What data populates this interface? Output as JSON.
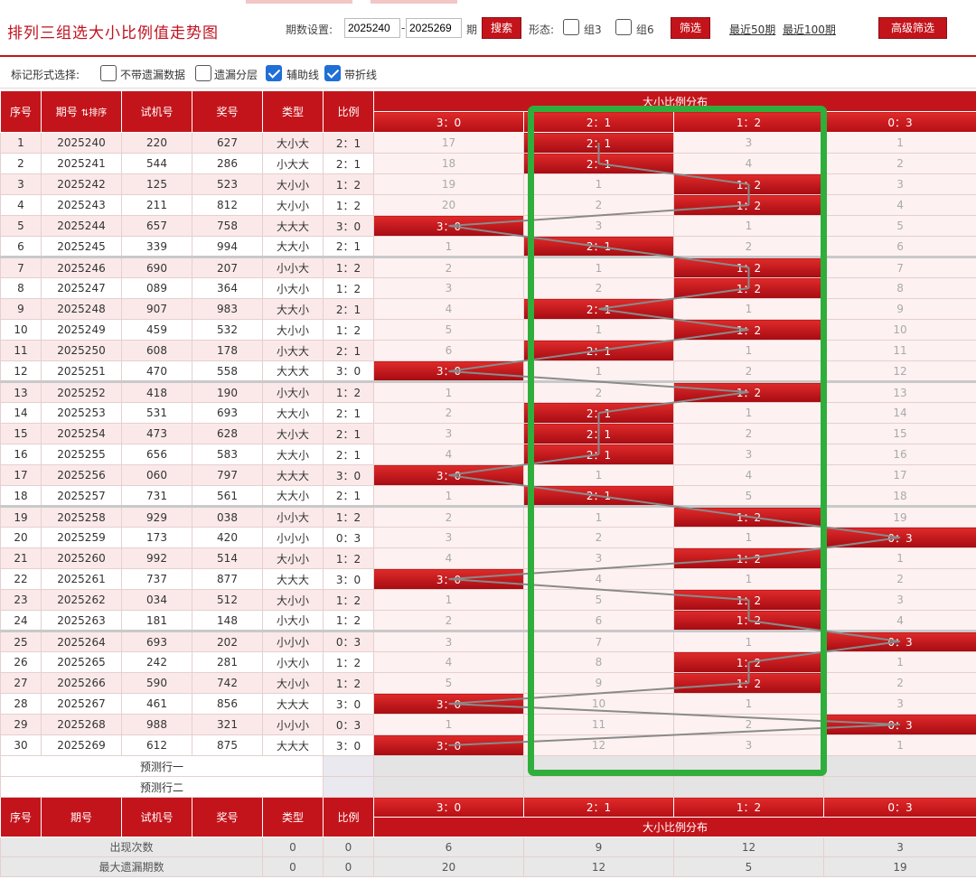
{
  "header": {
    "title": "排列三组选大小比例值走势图",
    "period_label": "期数设置:",
    "period_from": "2025240",
    "period_to": "2025269",
    "period_suffix": "期",
    "search_label": "搜索",
    "form_label": "形态:",
    "form_opt1": "组3",
    "form_opt2": "组6",
    "filter_label": "筛选",
    "recent50": "最近50期",
    "recent100": "最近100期",
    "advanced": "高级筛选"
  },
  "options": {
    "label": "标记形式选择:",
    "opt1": "不带遗漏数据",
    "opt2": "遗漏分层",
    "opt3": "辅助线",
    "opt4": "带折线",
    "opt1_checked": false,
    "opt2_checked": false,
    "opt3_checked": true,
    "opt4_checked": true
  },
  "columns": {
    "seq": "序号",
    "issue": "期号",
    "sort": "排序",
    "test": "试机号",
    "prize": "奖号",
    "type": "类型",
    "ratio": "比例",
    "dist_title": "大小比例分布",
    "dist": [
      "3：0",
      "2：1",
      "1：2",
      "0：3"
    ]
  },
  "rows": [
    {
      "seq": "1",
      "issue": "2025240",
      "test": "220",
      "prize": "627",
      "type": "大小大",
      "ratio": "2：1",
      "hit": 1,
      "miss": [
        "17",
        "",
        "3",
        "1"
      ]
    },
    {
      "seq": "2",
      "issue": "2025241",
      "test": "544",
      "prize": "286",
      "type": "小大大",
      "ratio": "2：1",
      "hit": 1,
      "miss": [
        "18",
        "",
        "4",
        "2"
      ]
    },
    {
      "seq": "3",
      "issue": "2025242",
      "test": "125",
      "prize": "523",
      "type": "大小小",
      "ratio": "1：2",
      "hit": 2,
      "miss": [
        "19",
        "1",
        "",
        "3"
      ]
    },
    {
      "seq": "4",
      "issue": "2025243",
      "test": "211",
      "prize": "812",
      "type": "大小小",
      "ratio": "1：2",
      "hit": 2,
      "miss": [
        "20",
        "2",
        "",
        "4"
      ]
    },
    {
      "seq": "5",
      "issue": "2025244",
      "test": "657",
      "prize": "758",
      "type": "大大大",
      "ratio": "3：0",
      "hit": 0,
      "miss": [
        "",
        "3",
        "1",
        "5"
      ]
    },
    {
      "seq": "6",
      "issue": "2025245",
      "test": "339",
      "prize": "994",
      "type": "大大小",
      "ratio": "2：1",
      "hit": 1,
      "miss": [
        "1",
        "",
        "2",
        "6"
      ]
    },
    {
      "seq": "7",
      "issue": "2025246",
      "test": "690",
      "prize": "207",
      "type": "小小大",
      "ratio": "1：2",
      "hit": 2,
      "miss": [
        "2",
        "1",
        "",
        "7"
      ]
    },
    {
      "seq": "8",
      "issue": "2025247",
      "test": "089",
      "prize": "364",
      "type": "小大小",
      "ratio": "1：2",
      "hit": 2,
      "miss": [
        "3",
        "2",
        "",
        "8"
      ]
    },
    {
      "seq": "9",
      "issue": "2025248",
      "test": "907",
      "prize": "983",
      "type": "大大小",
      "ratio": "2：1",
      "hit": 1,
      "miss": [
        "4",
        "",
        "1",
        "9"
      ]
    },
    {
      "seq": "10",
      "issue": "2025249",
      "test": "459",
      "prize": "532",
      "type": "大小小",
      "ratio": "1：2",
      "hit": 2,
      "miss": [
        "5",
        "1",
        "",
        "10"
      ]
    },
    {
      "seq": "11",
      "issue": "2025250",
      "test": "608",
      "prize": "178",
      "type": "小大大",
      "ratio": "2：1",
      "hit": 1,
      "miss": [
        "6",
        "",
        "1",
        "11"
      ]
    },
    {
      "seq": "12",
      "issue": "2025251",
      "test": "470",
      "prize": "558",
      "type": "大大大",
      "ratio": "3：0",
      "hit": 0,
      "miss": [
        "",
        "1",
        "2",
        "12"
      ]
    },
    {
      "seq": "13",
      "issue": "2025252",
      "test": "418",
      "prize": "190",
      "type": "小大小",
      "ratio": "1：2",
      "hit": 2,
      "miss": [
        "1",
        "2",
        "",
        "13"
      ]
    },
    {
      "seq": "14",
      "issue": "2025253",
      "test": "531",
      "prize": "693",
      "type": "大大小",
      "ratio": "2：1",
      "hit": 1,
      "miss": [
        "2",
        "",
        "1",
        "14"
      ]
    },
    {
      "seq": "15",
      "issue": "2025254",
      "test": "473",
      "prize": "628",
      "type": "大小大",
      "ratio": "2：1",
      "hit": 1,
      "miss": [
        "3",
        "",
        "2",
        "15"
      ]
    },
    {
      "seq": "16",
      "issue": "2025255",
      "test": "656",
      "prize": "583",
      "type": "大大小",
      "ratio": "2：1",
      "hit": 1,
      "miss": [
        "4",
        "",
        "3",
        "16"
      ]
    },
    {
      "seq": "17",
      "issue": "2025256",
      "test": "060",
      "prize": "797",
      "type": "大大大",
      "ratio": "3：0",
      "hit": 0,
      "miss": [
        "",
        "1",
        "4",
        "17"
      ]
    },
    {
      "seq": "18",
      "issue": "2025257",
      "test": "731",
      "prize": "561",
      "type": "大大小",
      "ratio": "2：1",
      "hit": 1,
      "miss": [
        "1",
        "",
        "5",
        "18"
      ]
    },
    {
      "seq": "19",
      "issue": "2025258",
      "test": "929",
      "prize": "038",
      "type": "小小大",
      "ratio": "1：2",
      "hit": 2,
      "miss": [
        "2",
        "1",
        "",
        "19"
      ]
    },
    {
      "seq": "20",
      "issue": "2025259",
      "test": "173",
      "prize": "420",
      "type": "小小小",
      "ratio": "0：3",
      "hit": 3,
      "miss": [
        "3",
        "2",
        "1",
        ""
      ]
    },
    {
      "seq": "21",
      "issue": "2025260",
      "test": "992",
      "prize": "514",
      "type": "大小小",
      "ratio": "1：2",
      "hit": 2,
      "miss": [
        "4",
        "3",
        "",
        "1"
      ]
    },
    {
      "seq": "22",
      "issue": "2025261",
      "test": "737",
      "prize": "877",
      "type": "大大大",
      "ratio": "3：0",
      "hit": 0,
      "miss": [
        "",
        "4",
        "1",
        "2"
      ]
    },
    {
      "seq": "23",
      "issue": "2025262",
      "test": "034",
      "prize": "512",
      "type": "大小小",
      "ratio": "1：2",
      "hit": 2,
      "miss": [
        "1",
        "5",
        "",
        "3"
      ]
    },
    {
      "seq": "24",
      "issue": "2025263",
      "test": "181",
      "prize": "148",
      "type": "小大小",
      "ratio": "1：2",
      "hit": 2,
      "miss": [
        "2",
        "6",
        "",
        "4"
      ]
    },
    {
      "seq": "25",
      "issue": "2025264",
      "test": "693",
      "prize": "202",
      "type": "小小小",
      "ratio": "0：3",
      "hit": 3,
      "miss": [
        "3",
        "7",
        "1",
        ""
      ]
    },
    {
      "seq": "26",
      "issue": "2025265",
      "test": "242",
      "prize": "281",
      "type": "小大小",
      "ratio": "1：2",
      "hit": 2,
      "miss": [
        "4",
        "8",
        "",
        "1"
      ]
    },
    {
      "seq": "27",
      "issue": "2025266",
      "test": "590",
      "prize": "742",
      "type": "大小小",
      "ratio": "1：2",
      "hit": 2,
      "miss": [
        "5",
        "9",
        "",
        "2"
      ]
    },
    {
      "seq": "28",
      "issue": "2025267",
      "test": "461",
      "prize": "856",
      "type": "大大大",
      "ratio": "3：0",
      "hit": 0,
      "miss": [
        "",
        "10",
        "1",
        "3"
      ]
    },
    {
      "seq": "29",
      "issue": "2025268",
      "test": "988",
      "prize": "321",
      "type": "小小小",
      "ratio": "0：3",
      "hit": 3,
      "miss": [
        "1",
        "11",
        "2",
        ""
      ]
    },
    {
      "seq": "30",
      "issue": "2025269",
      "test": "612",
      "prize": "875",
      "type": "大大大",
      "ratio": "3：0",
      "hit": 0,
      "miss": [
        "",
        "12",
        "3",
        "1"
      ]
    }
  ],
  "predict": [
    "预测行一",
    "预测行二"
  ],
  "stats": [
    {
      "label": "出现次数",
      "type": "0",
      "ratio": "0",
      "vals": [
        "6",
        "9",
        "12",
        "3"
      ]
    },
    {
      "label": "最大遗漏期数",
      "type": "0",
      "ratio": "0",
      "vals": [
        "20",
        "12",
        "5",
        "19"
      ]
    }
  ],
  "colors": {
    "accent": "#c4141b",
    "highlight_box": "#2fae3c",
    "line": "#8a8a8a",
    "check": "#1f6fd6"
  }
}
